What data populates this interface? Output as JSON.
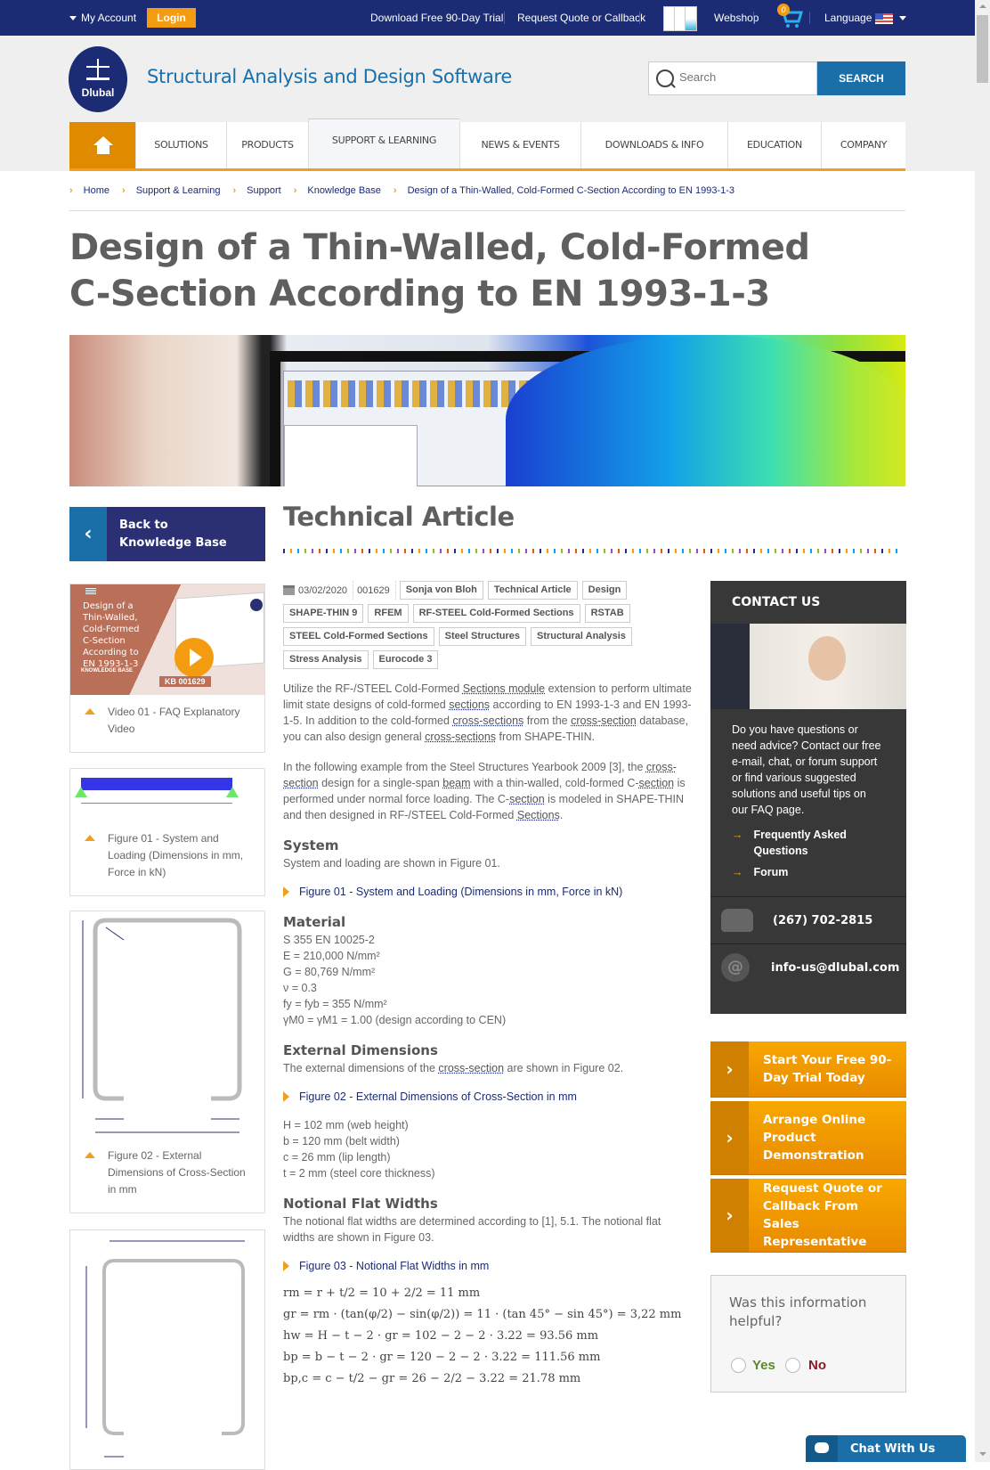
{
  "topbar": {
    "my_account": "My Account",
    "login": "Login",
    "download_trial": "Download Free 90-Day Trial",
    "request_quote": "Request Quote or Callback",
    "webshop": "Webshop",
    "cart_count": "0",
    "language": "Language"
  },
  "header": {
    "logo_text": "Dlubal",
    "site_title": "Structural Analysis and Design Software",
    "search_placeholder": "Search",
    "search_button": "SEARCH"
  },
  "nav": {
    "items": [
      "SOLUTIONS",
      "PRODUCTS",
      "SUPPORT & LEARNING",
      "NEWS & EVENTS",
      "DOWNLOADS & INFO",
      "EDUCATION",
      "COMPANY"
    ],
    "active": "SUPPORT & LEARNING"
  },
  "breadcrumb": [
    "Home",
    "Support & Learning",
    "Support",
    "Knowledge Base",
    "Design of a Thin-Walled, Cold-Formed C-Section According to EN 1993-1-3"
  ],
  "page": {
    "title": "Design of a Thin-Walled, Cold-Formed C-Section According to EN 1993-1-3",
    "section_heading": "Technical Article"
  },
  "sidebar_left": {
    "back_button": "Back to Knowledge Base",
    "video": {
      "thumb_title": "Design of a Thin-Walled, Cold-Formed C-Section According to EN 1993-1-3",
      "thumb_tag": "KNOWLEDGE BASE",
      "thumb_kb": "KB  001629",
      "caption": "Video 01 - FAQ Explanatory Video"
    },
    "figures": [
      {
        "caption": "Figure 01 - System and Loading (Dimensions in mm, Force in kN)"
      },
      {
        "caption": "Figure 02 - External Dimensions of Cross-Section in mm"
      },
      {
        "caption": "Figure 03 - Notional Flat Widths in mm"
      }
    ]
  },
  "article": {
    "date": "03/02/2020",
    "id": "001629",
    "tags": [
      "Sonja von Bloh",
      "Technical Article",
      "Design",
      "SHAPE-THIN 9",
      "RFEM",
      "RF-STEEL Cold-Formed Sections",
      "RSTAB",
      "STEEL Cold-Formed Sections",
      "Steel Structures",
      "Structural Analysis",
      "Stress Analysis",
      "Eurocode 3"
    ],
    "intro_p1": [
      "Utilize the RF-/STEEL Cold-Formed ",
      "Sections module",
      " extension to perform ultimate limit state designs of cold-formed ",
      "sections",
      " according to EN 1993-1-3 and EN 1993-1-5. In addition to the cold-formed ",
      "cross-sections",
      " from the ",
      "cross-section",
      " database, you can also design general ",
      "cross-sections",
      " from SHAPE-THIN."
    ],
    "intro_p2": [
      "In the following example from the Steel Structures Yearbook 2009 [3], the ",
      "cross-section",
      " design for a single-span ",
      "beam",
      " with a thin-walled, cold-formed C-",
      "section",
      " is performed under normal force loading. The C-",
      "section",
      " is modeled in SHAPE-THIN and then designed in RF-/STEEL Cold-Formed ",
      "Sections",
      "."
    ],
    "system": {
      "heading": "System",
      "text": "System and loading are shown in Figure 01.",
      "figure_link": "Figure 01 - System and Loading (Dimensions in mm, Force in kN)"
    },
    "material": {
      "heading": "Material",
      "lines": [
        "S 355 EN 10025-2",
        "E = 210,000 N/mm²",
        "G = 80,769 N/mm²",
        "ν = 0.3",
        "fy = fyb = 355 N/mm²",
        "γM0 = γM1 = 1.00 (design according to CEN)"
      ]
    },
    "external": {
      "heading": "External Dimensions",
      "text_before": "The external dimensions of the ",
      "link": "cross-section",
      "text_after": " are shown in Figure 02.",
      "figure_link": "Figure 02 - External Dimensions of Cross-Section in mm",
      "lines": [
        "H = 102 mm (web height)",
        "b = 120 mm (belt width)",
        "c = 26 mm (lip length)",
        "t = 2 mm (steel core thickness)"
      ]
    },
    "notional": {
      "heading": "Notional Flat Widths",
      "text": "The notional flat widths are determined according to [1], 5.1. The notional flat widths are shown in Figure 03.",
      "figure_link": "Figure 03 - Notional Flat Widths in mm",
      "equations": [
        "rm = r + t/2 = 10 + 2/2 = 11 mm",
        "gr = rm · (tan(φ/2) − sin(φ/2)) = 11 · (tan 45° − sin 45°) = 3,22 mm",
        "hw = H − t − 2 · gr = 102 − 2 − 2 · 3.22 = 93.56 mm",
        "bp = b − t − 2 · gr = 120 − 2 − 2 · 3.22 = 111.56 mm",
        "bp,c = c − t/2 − gr = 26 − 2/2 − 3.22 = 21.78 mm"
      ]
    }
  },
  "contact": {
    "heading": "CONTACT US",
    "text": "Do you have questions or need advice? Contact our free e-mail, chat, or forum support or find various suggested solutions and useful tips on our FAQ page.",
    "links": [
      "Frequently Asked Questions",
      "Forum"
    ],
    "phone": "(267) 702-2815",
    "email": "info-us@dlubal.com"
  },
  "cta_buttons": [
    "Start Your Free 90-Day Trial Today",
    "Arrange Online Product Demonstration",
    "Request Quote or Callback From Sales Representative"
  ],
  "feedback": {
    "question": "Was this information helpful?",
    "yes": "Yes",
    "no": "No"
  },
  "chat": {
    "label": "Chat With Us"
  },
  "colors": {
    "navy": "#1b2b74",
    "orange": "#f0a020",
    "blue": "#1b6fa8",
    "dark": "#383838"
  }
}
